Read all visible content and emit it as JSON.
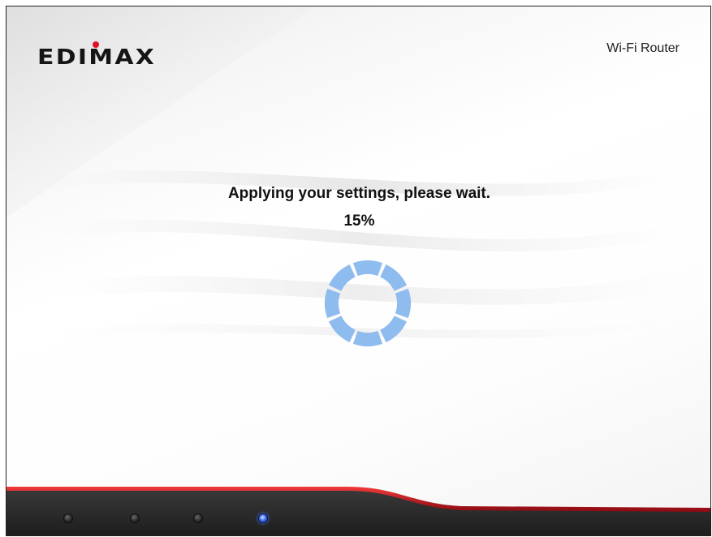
{
  "header": {
    "brand": "EDIMAX",
    "product": "Wi-Fi Router"
  },
  "status": {
    "message": "Applying your settings, please wait.",
    "progress_text": "15%",
    "progress_value": 15
  },
  "spinner": {
    "icon": "loading-spinner-icon",
    "color": "#8fbcef",
    "segments": 8
  },
  "footer": {
    "leds": [
      {
        "name": "power-led",
        "state": "off"
      },
      {
        "name": "wireless-led",
        "state": "off"
      },
      {
        "name": "lan-led",
        "state": "off"
      },
      {
        "name": "wps-led",
        "state": "on"
      }
    ],
    "accent_color": "#c8101e",
    "base_color": "#2b2b2b"
  }
}
